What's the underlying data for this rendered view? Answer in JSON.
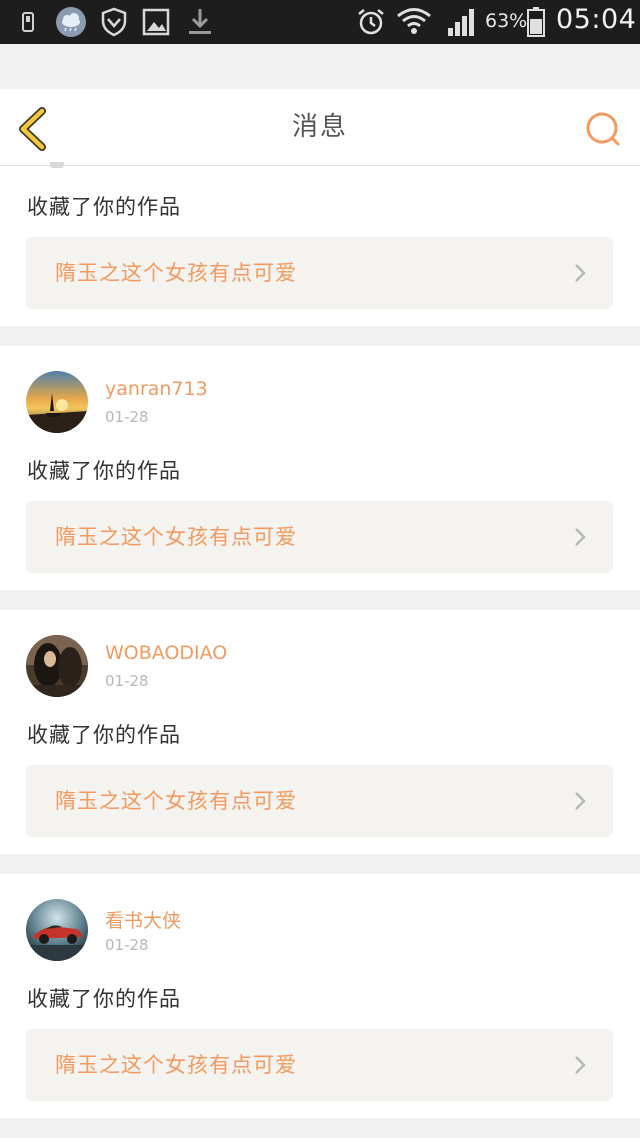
{
  "status_bar": {
    "battery_percent": "63%",
    "time": "05:04"
  },
  "header": {
    "title": "消息"
  },
  "colors": {
    "accent": "#f29a61",
    "back_arrow": "#f5c73a",
    "status_bar_bg": "#1d1d1d",
    "link_box_bg": "#f4f3ef",
    "page_bg": "#f2f2f2"
  },
  "messages": [
    {
      "username": "",
      "date": "",
      "action": "收藏了你的作品",
      "work_title": "隋玉之这个女孩有点可爱"
    },
    {
      "username": "yanran713",
      "date": "01-28",
      "action": "收藏了你的作品",
      "work_title": "隋玉之这个女孩有点可爱"
    },
    {
      "username": "WOBAODIAO",
      "date": "01-28",
      "action": "收藏了你的作品",
      "work_title": "隋玉之这个女孩有点可爱"
    },
    {
      "username": "看书大侠",
      "date": "01-28",
      "action": "收藏了你的作品",
      "work_title": "隋玉之这个女孩有点可爱"
    }
  ]
}
